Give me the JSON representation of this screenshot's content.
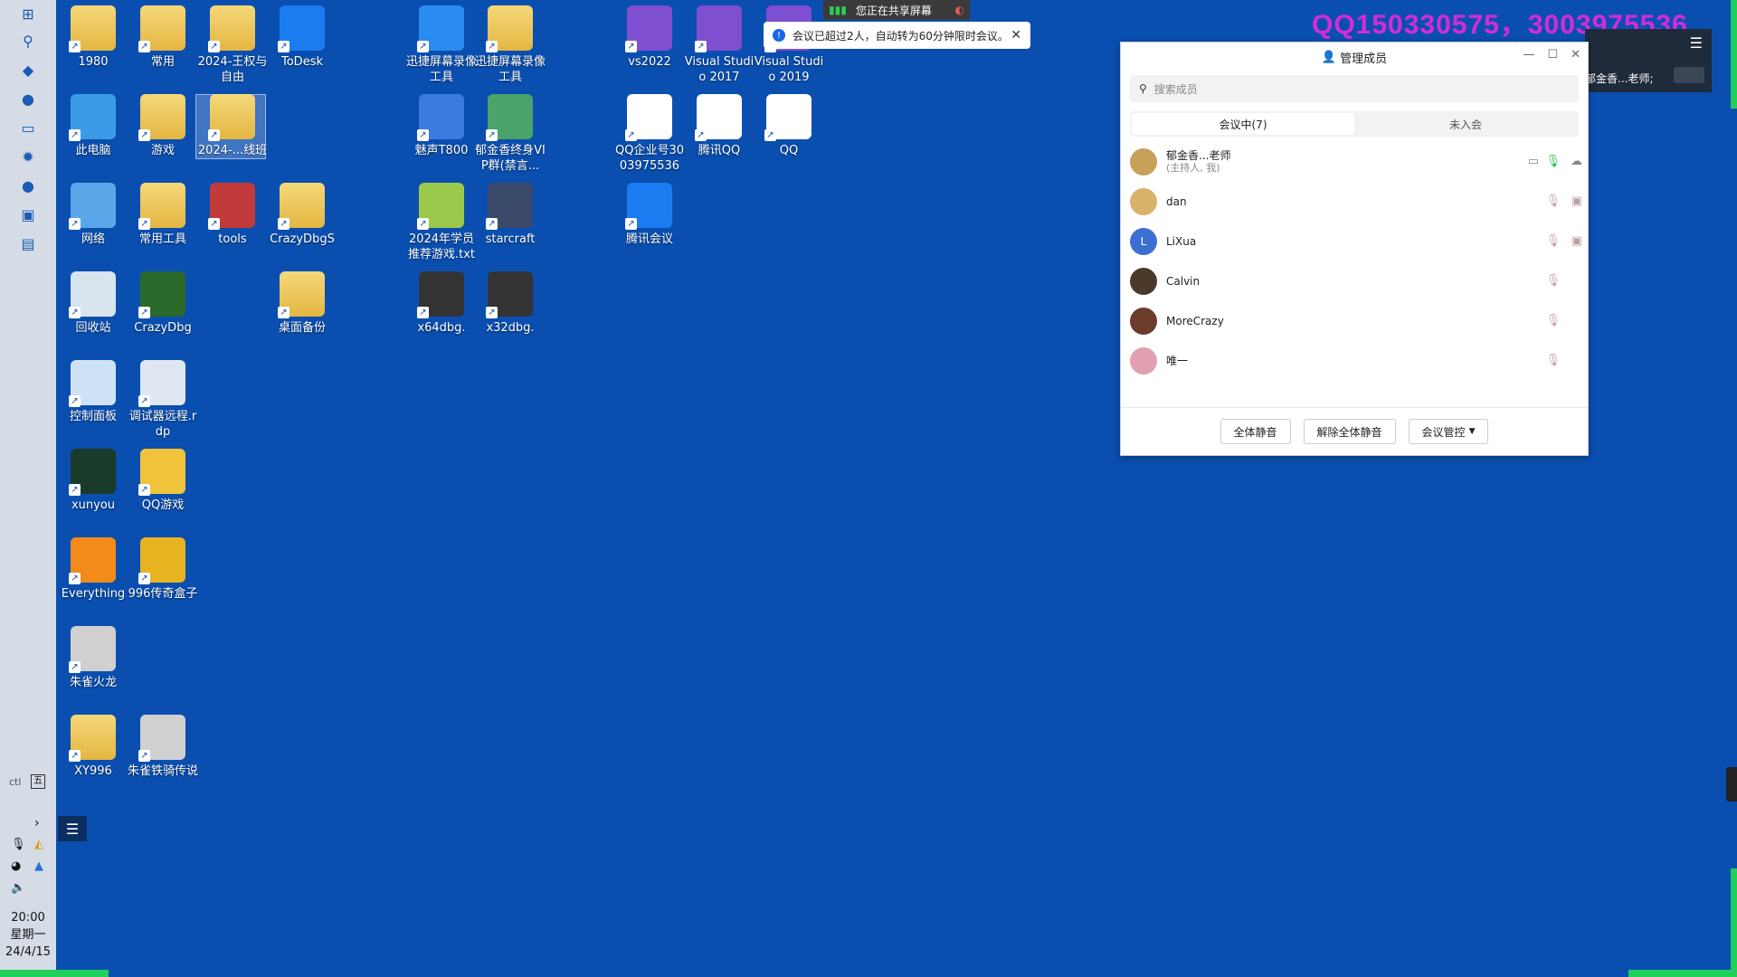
{
  "taskbar": {
    "clock_time": "20:00",
    "clock_weekday": "星期一",
    "clock_date": "24/4/15",
    "ime_mode": "五",
    "ime_left": "ctl"
  },
  "desktop": {
    "icons": [
      {
        "label": "1980",
        "icon": "user-folder-icon"
      },
      {
        "label": "常用",
        "icon": "folder-icon"
      },
      {
        "label": "2024-王权与自由",
        "icon": "folder-icon"
      },
      {
        "label": "ToDesk",
        "icon": "todesk-icon"
      },
      {
        "label": "迅捷屏幕录像工具",
        "icon": "screen-recorder-icon"
      },
      {
        "label": "迅捷屏幕录像工具",
        "icon": "folder-icon"
      },
      {
        "label": "vs2022",
        "icon": "visual-studio-icon"
      },
      {
        "label": "Visual Studio 2017",
        "icon": "visual-studio-icon"
      },
      {
        "label": "Visual Studio 2019",
        "icon": "visual-studio-icon"
      },
      {
        "label": "此电脑",
        "icon": "computer-icon"
      },
      {
        "label": "游戏",
        "icon": "folder-icon"
      },
      {
        "label": "2024-...线班",
        "icon": "folder-icon"
      },
      {
        "label": "魅声T800",
        "icon": "audio-app-icon"
      },
      {
        "label": "郁金香终身VIP群(禁言...",
        "icon": "group-chat-icon"
      },
      {
        "label": "QQ企业号3003975536",
        "icon": "qq-enterprise-icon"
      },
      {
        "label": "腾讯QQ",
        "icon": "qq-penguin-icon"
      },
      {
        "label": "QQ",
        "icon": "qq-penguin-icon"
      },
      {
        "label": "网络",
        "icon": "network-icon"
      },
      {
        "label": "常用工具",
        "icon": "folder-icon"
      },
      {
        "label": "tools",
        "icon": "winrar-icon"
      },
      {
        "label": "CrazyDbgS",
        "icon": "folder-icon"
      },
      {
        "label": "2024年学员推荐游戏.txt",
        "icon": "text-file-icon"
      },
      {
        "label": "starcraft",
        "icon": "starcraft-icon"
      },
      {
        "label": "腾讯会议",
        "icon": "tencent-meeting-icon"
      },
      {
        "label": "回收站",
        "icon": "recycle-bin-icon"
      },
      {
        "label": "CrazyDbg",
        "icon": "crazydbg-icon"
      },
      {
        "label": "桌面备份",
        "icon": "folder-icon"
      },
      {
        "label": "x64dbg.",
        "icon": "x64dbg-icon"
      },
      {
        "label": "x32dbg.",
        "icon": "x32dbg-icon"
      },
      {
        "label": "控制面板",
        "icon": "control-panel-icon"
      },
      {
        "label": "调试器远程.rdp",
        "icon": "remote-desktop-icon"
      },
      {
        "label": "xunyou",
        "icon": "xunyou-icon"
      },
      {
        "label": "QQ游戏",
        "icon": "qq-game-icon"
      },
      {
        "label": "Everything",
        "icon": "everything-search-icon"
      },
      {
        "label": "996传奇盒子",
        "icon": "game-box-icon"
      },
      {
        "label": "朱雀火龙",
        "icon": "game-icon"
      },
      {
        "label": "XY996",
        "icon": "folder-icon"
      },
      {
        "label": "朱雀铁骑传说",
        "icon": "game-icon"
      }
    ]
  },
  "sharing_bar": {
    "text": "您正在共享屏幕"
  },
  "toast": {
    "text": "会议已超过2人，自动转为60分钟限时会议。"
  },
  "watermark": {
    "text": "QQ150330575，3003975536"
  },
  "mini_window": {
    "host_label": "郁金香...老师;"
  },
  "panel": {
    "title": "管理成员",
    "search_placeholder": "搜索成员",
    "tabs": [
      {
        "label": "会议中(7)",
        "active": true
      },
      {
        "label": "未入会",
        "active": false
      }
    ],
    "members": [
      {
        "name": "郁金香...老师",
        "role": "(主持人, 我)",
        "avatar_color": "#c8a25a",
        "mic": "on"
      },
      {
        "name": "dan",
        "role": "",
        "avatar_color": "#d9b36a",
        "mic": "muted"
      },
      {
        "name": "LiXua",
        "role": "",
        "avatar_color": "#3b6fd1",
        "avatar_letter": "L",
        "mic": "muted"
      },
      {
        "name": "Calvin",
        "role": "",
        "avatar_color": "#4b3a2a",
        "mic": "muted"
      },
      {
        "name": "MoreCrazy",
        "role": "",
        "avatar_color": "#6b3b2b",
        "mic": "muted"
      },
      {
        "name": "唯一",
        "role": "",
        "avatar_color": "#e2a0b0",
        "mic": "muted"
      }
    ],
    "footer_buttons": {
      "mute_all": "全体静音",
      "unmute_all": "解除全体静音",
      "meeting_control": "会议管控"
    }
  },
  "colors": {
    "desktop_bg": "#0a4fb0",
    "accent_green": "#1fd15a",
    "watermark": "#d52ad8"
  }
}
